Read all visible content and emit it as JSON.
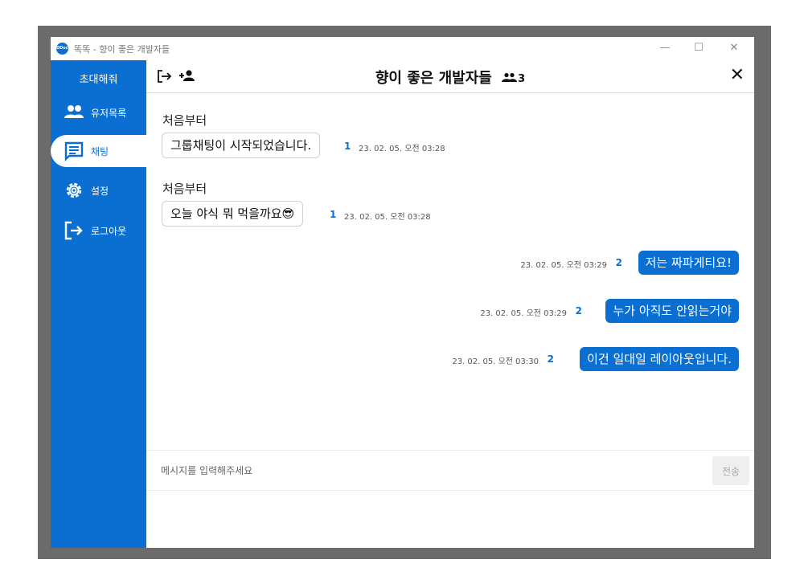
{
  "window": {
    "app_icon_text": "DDock",
    "title": "똑똑 - 향이 좋은 개발자들",
    "controls": {
      "minimize": "—",
      "maximize": "☐",
      "close": "✕"
    }
  },
  "sidebar": {
    "invite_label": "초대해줘",
    "items": [
      {
        "label": "유저목록",
        "icon": "people-icon"
      },
      {
        "label": "채팅",
        "icon": "chat-icon",
        "active": true
      },
      {
        "label": "설정",
        "icon": "gear-icon"
      },
      {
        "label": "로그아웃",
        "icon": "logout-icon"
      }
    ],
    "accent_color": "#0a6fd1"
  },
  "header": {
    "room_title": "향이 좋은 개발자들",
    "member_count": "3",
    "close_label": "✕"
  },
  "messages": [
    {
      "direction": "in",
      "sender": "처음부터",
      "text": "그룹채팅이 시작되었습니다.",
      "unread": "1",
      "time": "23. 02. 05. 오전 03:28"
    },
    {
      "direction": "in",
      "sender": "처음부터",
      "text": "오늘 야식 뭐 먹을까요😎",
      "unread": "1",
      "time": "23. 02. 05. 오전 03:28"
    },
    {
      "direction": "out",
      "text": "저는 짜파게티요!",
      "unread": "2",
      "time": "23. 02. 05. 오전 03:29"
    },
    {
      "direction": "out",
      "text": "누가 아직도 안읽는거야",
      "unread": "2",
      "time": "23. 02. 05. 오전 03:29"
    },
    {
      "direction": "out",
      "text": "이건 일대일 레이아웃입니다.",
      "unread": "2",
      "time": "23. 02. 05. 오전 03:30"
    }
  ],
  "composer": {
    "placeholder": "메시지를 입력해주세요",
    "value": "",
    "send_label": "전송"
  }
}
